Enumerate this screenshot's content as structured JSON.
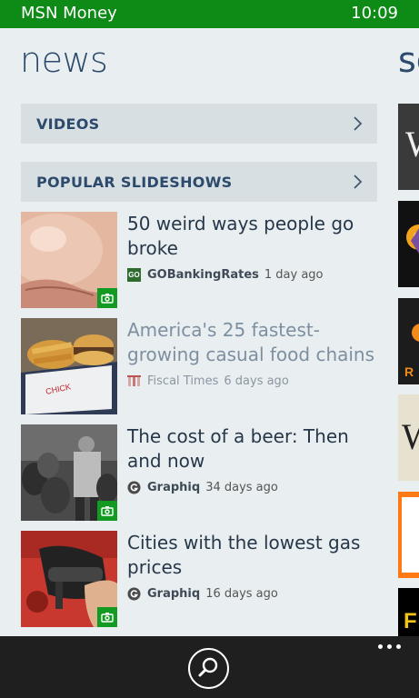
{
  "status": {
    "app_name": "MSN Money",
    "time": "10:09"
  },
  "page": {
    "title": "news",
    "next_title": "sc"
  },
  "sections": [
    {
      "label": "VIDEOS"
    },
    {
      "label": "POPULAR SLIDESHOWS"
    }
  ],
  "articles": [
    {
      "headline": "50 weird ways people go broke",
      "source": "GOBankingRates",
      "source_logo_text": "GO",
      "age": "1 day ago",
      "read": false,
      "has_slideshow": true
    },
    {
      "headline": "America's 25 fastest-growing casual food chains",
      "source": "Fiscal Times",
      "age": "6 days ago",
      "read": true,
      "has_slideshow": false
    },
    {
      "headline": "The cost of a beer: Then and now",
      "source": "Graphiq",
      "age": "34 days ago",
      "read": false,
      "has_slideshow": true
    },
    {
      "headline": "Cities with the lowest gas prices",
      "source": "Graphiq",
      "age": "16 days ago",
      "read": false,
      "has_slideshow": true
    }
  ],
  "colors": {
    "status_bar": "#0e8a16",
    "accent": "#139a23",
    "title": "#2c4a6b",
    "app_bar": "#1f1f1f"
  },
  "icons": [
    "search-icon",
    "more-icon",
    "camera-icon",
    "chevron-right-icon"
  ]
}
